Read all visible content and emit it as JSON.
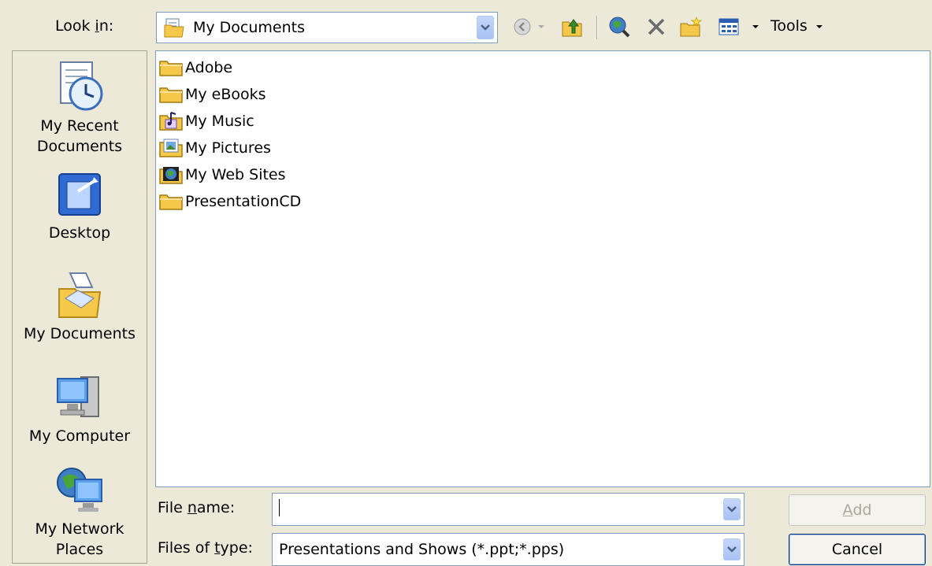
{
  "look_in": {
    "label": "Look in:",
    "value": "My Documents",
    "icon": "my-documents-folder-icon"
  },
  "toolbar": {
    "tools_label": "Tools",
    "icons": [
      "back-icon",
      "up-one-level-icon",
      "search-web-icon",
      "delete-icon",
      "new-folder-icon",
      "views-icon"
    ]
  },
  "places": [
    {
      "label_line1": "My Recent",
      "label_line2": "Documents",
      "icon": "recent-documents-icon"
    },
    {
      "label_line1": "Desktop",
      "label_line2": "",
      "icon": "desktop-icon"
    },
    {
      "label_line1": "My Documents",
      "label_line2": "",
      "icon": "my-documents-icon"
    },
    {
      "label_line1": "My Computer",
      "label_line2": "",
      "icon": "my-computer-icon"
    },
    {
      "label_line1": "My Network",
      "label_line2": "Places",
      "icon": "network-places-icon"
    }
  ],
  "files": [
    {
      "name": "Adobe",
      "icon": "folder-icon"
    },
    {
      "name": "My eBooks",
      "icon": "folder-icon"
    },
    {
      "name": "My Music",
      "icon": "music-folder-icon"
    },
    {
      "name": "My Pictures",
      "icon": "pictures-folder-icon"
    },
    {
      "name": "My Web Sites",
      "icon": "web-sites-folder-icon"
    },
    {
      "name": "PresentationCD",
      "icon": "folder-icon"
    }
  ],
  "file_name": {
    "label_pre": "File ",
    "label_ul": "n",
    "label_post": "ame:",
    "value": ""
  },
  "file_type": {
    "label_pre": "Files of ",
    "label_ul": "t",
    "label_post": "ype:",
    "value": "Presentations and Shows (*.ppt;*.pps)"
  },
  "buttons": {
    "add_ul": "A",
    "add_rest": "dd",
    "cancel": "Cancel"
  },
  "colors": {
    "dialog_bg": "#ece9d8",
    "border": "#7f9db9",
    "button_border": "#003c74",
    "folder_yellow": "#f5c84a"
  }
}
